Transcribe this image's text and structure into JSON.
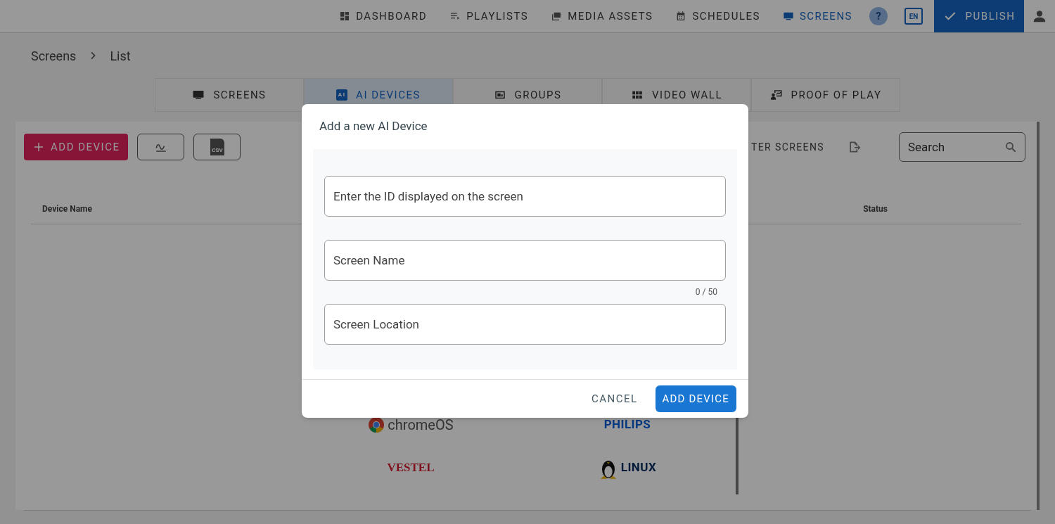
{
  "nav": {
    "items": [
      {
        "label": "DASHBOARD",
        "selected": false
      },
      {
        "label": "PLAYLISTS",
        "selected": false
      },
      {
        "label": "MEDIA ASSETS",
        "selected": false
      },
      {
        "label": "SCHEDULES",
        "selected": false
      },
      {
        "label": "SCREENS",
        "selected": true
      }
    ],
    "help": "?",
    "language": "EN",
    "publish": "PUBLISH"
  },
  "breadcrumb": [
    "Screens",
    "List"
  ],
  "tabs": [
    {
      "label": "SCREENS",
      "selected": false
    },
    {
      "label": "AI DEVICES",
      "icon_text": "AI",
      "selected": true
    },
    {
      "label": "GROUPS",
      "selected": false
    },
    {
      "label": "VIDEO WALL",
      "selected": false
    },
    {
      "label": "PROOF OF PLAY",
      "selected": false
    }
  ],
  "toolbar": {
    "add_button": "ADD DEVICE",
    "csv_label": "CSV",
    "filter_label": "TER SCREENS",
    "search": {
      "placeholder": "Search"
    }
  },
  "table": {
    "columns": [
      "Device Name",
      "Status"
    ]
  },
  "platforms": [
    {
      "label": "chromeOS",
      "kind": "chrome"
    },
    {
      "label": "PHILIPS",
      "kind": "philips"
    },
    {
      "label": "VESTEL",
      "kind": "vestel"
    },
    {
      "label": "LINUX",
      "kind": "linux"
    }
  ],
  "dialog": {
    "title": "Add a new AI Device",
    "fields": [
      {
        "placeholder": "Enter the ID displayed on the screen"
      },
      {
        "placeholder": "Screen Name",
        "counter": "0 / 50"
      },
      {
        "placeholder": "Screen Location"
      }
    ],
    "cancel": "CANCEL",
    "confirm": "ADD DEVICE"
  }
}
